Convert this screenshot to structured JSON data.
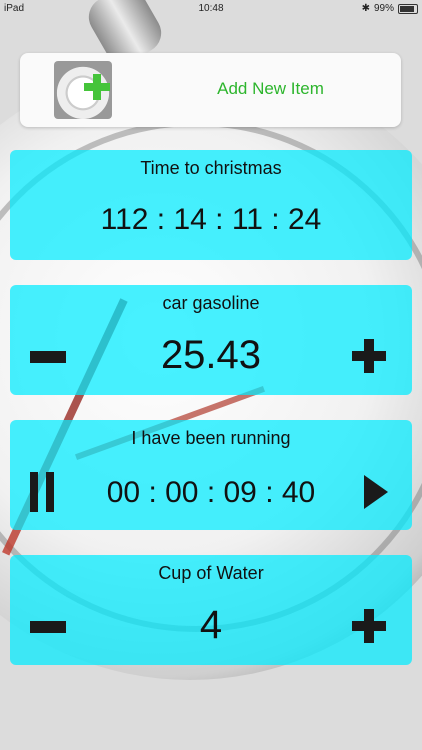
{
  "status_bar": {
    "device": "iPad",
    "time": "10:48",
    "battery_text": "99"
  },
  "add_item": {
    "label": "Add New Item",
    "thumbnail_icon": "stopwatch-plus-icon"
  },
  "items": [
    {
      "title": "Time to christmas",
      "display": "112 :  14  :  11  :  24",
      "type": "countdown"
    },
    {
      "title": "car gasoline",
      "display": "25.43",
      "type": "counter"
    },
    {
      "title": "I have been running",
      "display": "00  :  00  :  09  :  40",
      "type": "stopwatch"
    },
    {
      "title": "Cup of Water",
      "display": "4",
      "type": "counter"
    }
  ],
  "colors": {
    "card": "#00ecff",
    "add_label": "#2db52d",
    "plus_green": "#45c43a"
  }
}
